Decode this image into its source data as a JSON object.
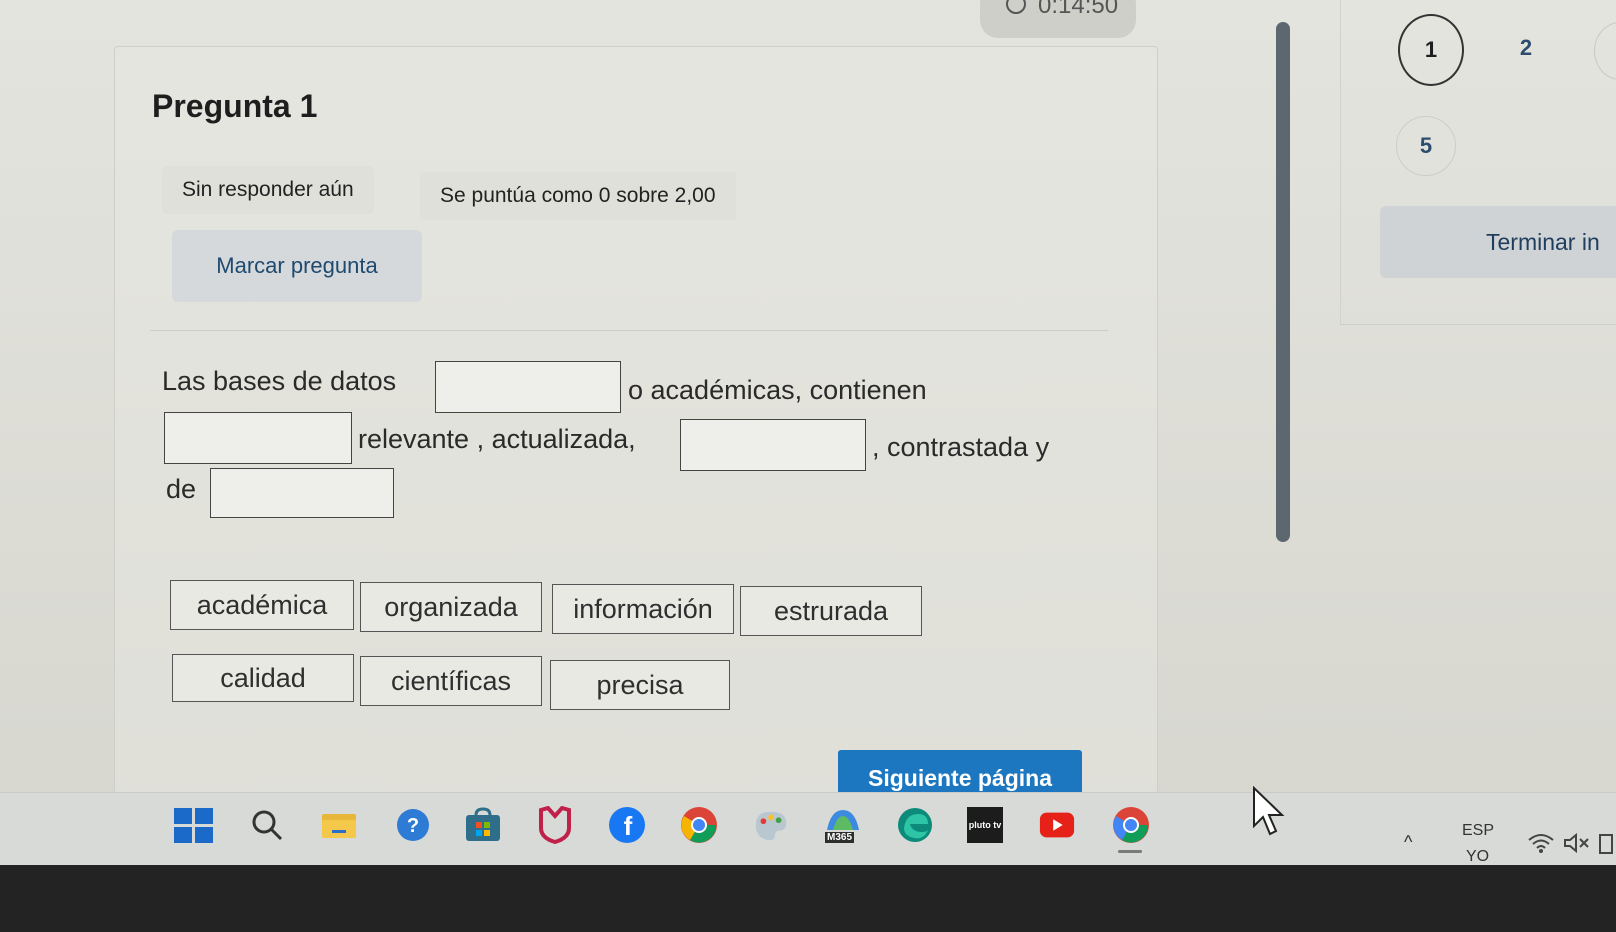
{
  "timer": {
    "text": "0:14:50"
  },
  "question": {
    "title": "Pregunta 1",
    "status": "Sin responder aún",
    "score": "Se puntúa como 0 sobre 2,00",
    "flag_label": "Marcar pregunta",
    "text_parts": [
      "Las bases de datos",
      "o académicas, contienen",
      "relevante , actualizada,",
      ", contrastada y",
      "de"
    ]
  },
  "drag_options": [
    "académica",
    "organizada",
    "información",
    "estrurada",
    "calidad",
    "científicas",
    "precisa"
  ],
  "next_label": "Siguiente página",
  "navigation": {
    "numbers": [
      "1",
      "2",
      "5"
    ],
    "finish_label": "Terminar in"
  },
  "taskbar": {
    "icons": [
      "windows-start-icon",
      "search-icon",
      "file-explorer-icon",
      "help-icon",
      "store-icon",
      "shield-icon",
      "facebook-icon",
      "chrome-icon",
      "paint-icon",
      "m365-icon",
      "edge-icon",
      "pluto-tv-icon",
      "youtube-icon",
      "chrome-alt-icon"
    ],
    "m365_label": "M365",
    "pluto_label": "pluto tv",
    "lang_top": "ESP",
    "lang_bottom": "YO",
    "tray_chevron": "^"
  },
  "colors": {
    "primary": "#1c77c0",
    "flag_text": "#1f4a70",
    "background": "#dcdcd5"
  }
}
